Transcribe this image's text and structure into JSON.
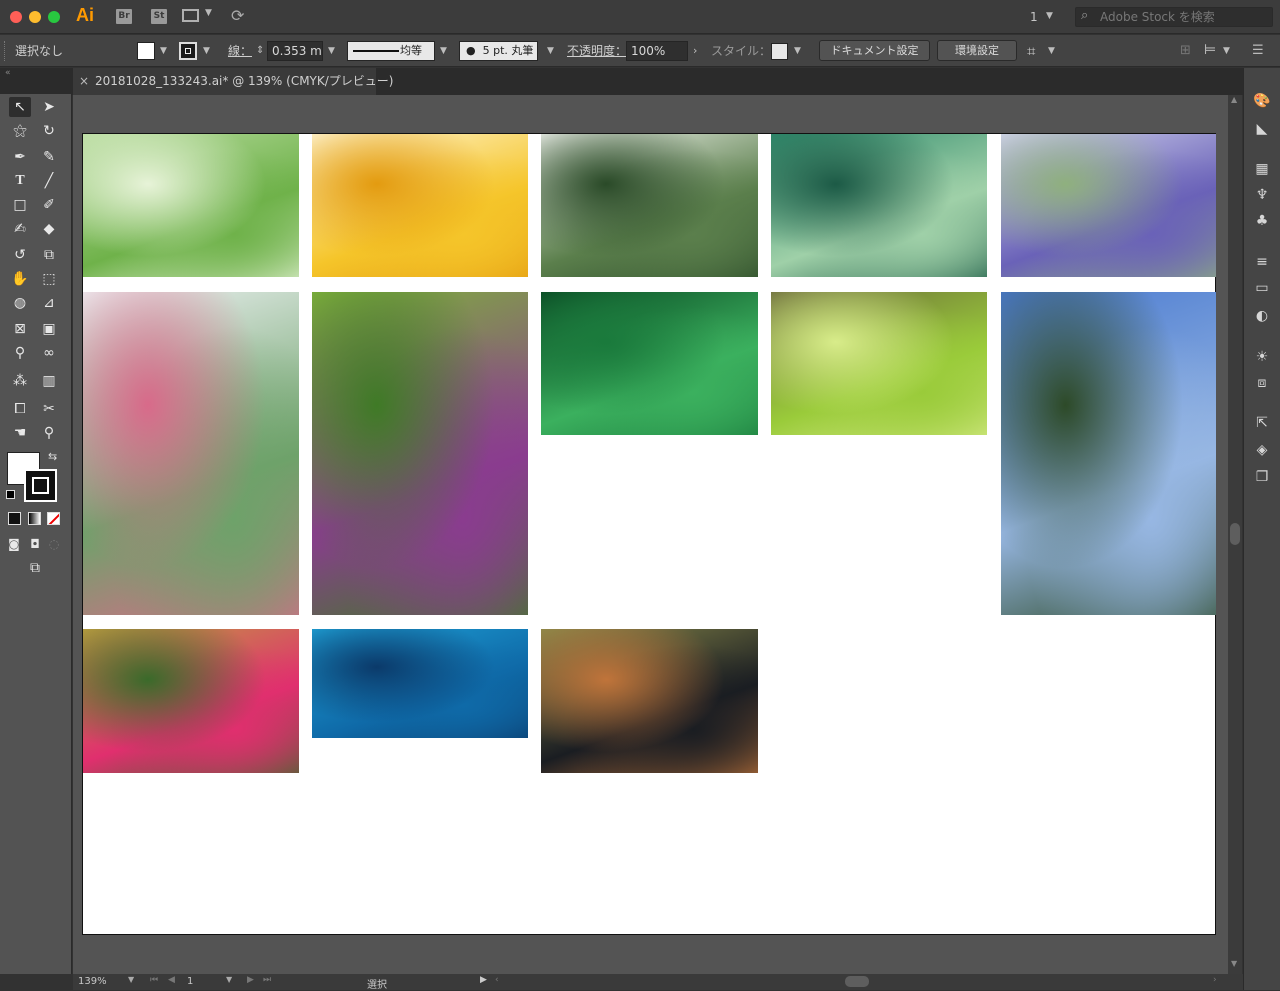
{
  "app": {
    "logo_text": "Ai",
    "bridge_label": "Br",
    "stock_label": "St",
    "page_menu": "1",
    "search_placeholder": "Adobe Stock を検索"
  },
  "control": {
    "selection": "選択なし",
    "stroke_label": "線：",
    "stroke_weight": "0.353 m",
    "stroke_profile": "均等",
    "brush": "5 pt. 丸筆",
    "opacity_label": "不透明度：",
    "opacity_value": "100%",
    "style_label": "スタイル：",
    "doc_setup": "ドキュメント設定",
    "preferences": "環境設定"
  },
  "document": {
    "tab_title": "20181028_133243.ai* @ 139% (CMYK/プレビュー)",
    "close_glyph": "×"
  },
  "status": {
    "zoom": "139%",
    "page": "1",
    "tool": "選択"
  },
  "colors": {
    "accent": "#ff9a00",
    "fill": "#ffffff",
    "stroke": "#000000"
  },
  "images": [
    {
      "name": "white-flowers-grass-photo",
      "colors": [
        "#b9dca0",
        "#6fb24a",
        "#e7f3d8"
      ]
    },
    {
      "name": "sunflower-photo",
      "colors": [
        "#fff7d8",
        "#f5c52a",
        "#e39b10"
      ]
    },
    {
      "name": "white-blossom-bush-photo",
      "colors": [
        "#f2f4ef",
        "#5b7f4c",
        "#2a4a28"
      ]
    },
    {
      "name": "wet-leaves-photo",
      "colors": [
        "#2f8a6c",
        "#9fd0a8",
        "#1c5a46"
      ]
    },
    {
      "name": "lavender-field-photo",
      "colors": [
        "#d2d4ee",
        "#6a62b8",
        "#8fb07e"
      ]
    },
    {
      "name": "climbing-rose-arch-photo",
      "colors": [
        "#eef2f4",
        "#6ea26a",
        "#d86a8a"
      ]
    },
    {
      "name": "purple-lavender-stalks-photo",
      "colors": [
        "#7fb23c",
        "#8a3c8f",
        "#3f7a26"
      ]
    },
    {
      "name": "ivy-leaves-photo",
      "colors": [
        "#0a4a24",
        "#3bb05e",
        "#1a7a3c"
      ]
    },
    {
      "name": "green-shrub-photo",
      "colors": [
        "#6a6a3a",
        "#9acb3a",
        "#d8ec8a"
      ]
    },
    {
      "name": "sky-white-roses-photo",
      "colors": [
        "#4a7ad0",
        "#97b7e3",
        "#2d4a28"
      ]
    },
    {
      "name": "pink-rose-photo",
      "colors": [
        "#c0a040",
        "#e02f6e",
        "#3a6a2a"
      ]
    },
    {
      "name": "water-drops-blue-photo",
      "colors": [
        "#1fa3d8",
        "#0f6aa8",
        "#0b3a6a"
      ]
    },
    {
      "name": "wristwatch-photo",
      "colors": [
        "#8a8a4a",
        "#1a1d22",
        "#c0743a"
      ]
    }
  ]
}
